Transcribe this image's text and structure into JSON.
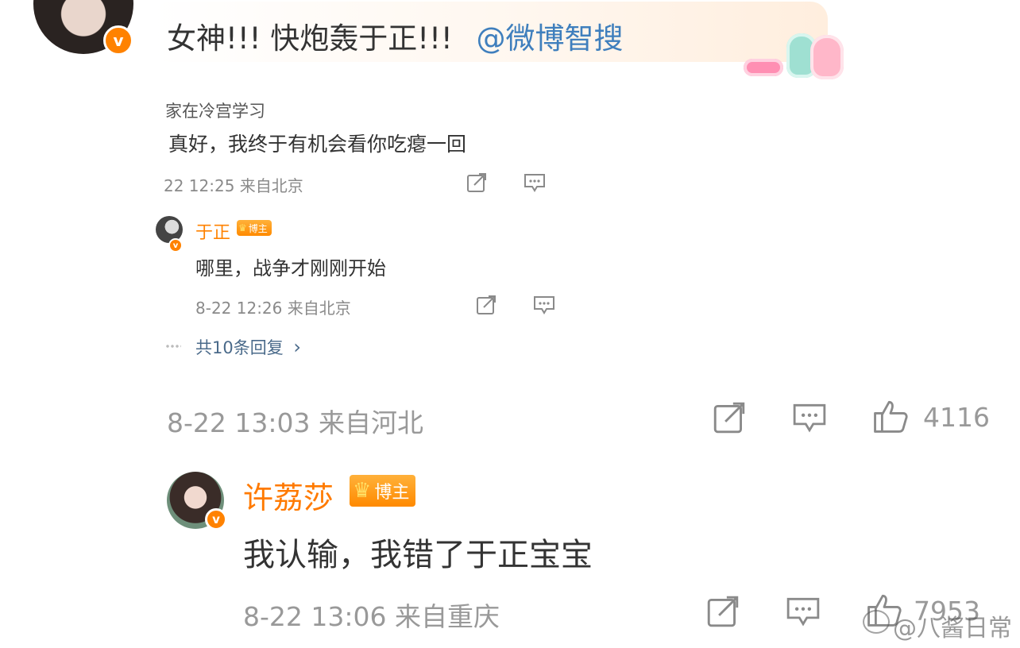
{
  "top_comment": {
    "text": "女神!!! 快炮轰于正!!!",
    "mention": "@微博智搜",
    "meta": "8-22 13:03 来自河北",
    "like_count": "4116"
  },
  "nested_comment": {
    "user": "家在冷宫学习",
    "text": "真好，我终于有机会看你吃瘪一回",
    "meta": "22 12:25 来自北京"
  },
  "nested_reply": {
    "user": "于正",
    "badge": "博主",
    "text": "哪里，战争才刚刚开始",
    "meta": "8-22 12:26 来自北京"
  },
  "replies_link": {
    "label": "共10条回复",
    "chevron": "›"
  },
  "second_comment": {
    "user": "许荔莎",
    "badge": "博主",
    "text": "我认输，我错了于正宝宝",
    "meta": "8-22 13:06 来自重庆",
    "like_count": "7953"
  },
  "watermark": {
    "text": "@八酱日常"
  },
  "icons": {
    "share": "share-icon",
    "comment": "comment-icon",
    "like": "thumbs-up-icon",
    "verified": "verified-v-icon",
    "crown": "crown-icon"
  },
  "colors": {
    "accent_orange": "#ff8200",
    "mention_blue": "#3f7fbd",
    "meta_gray": "#8a8a8a"
  }
}
